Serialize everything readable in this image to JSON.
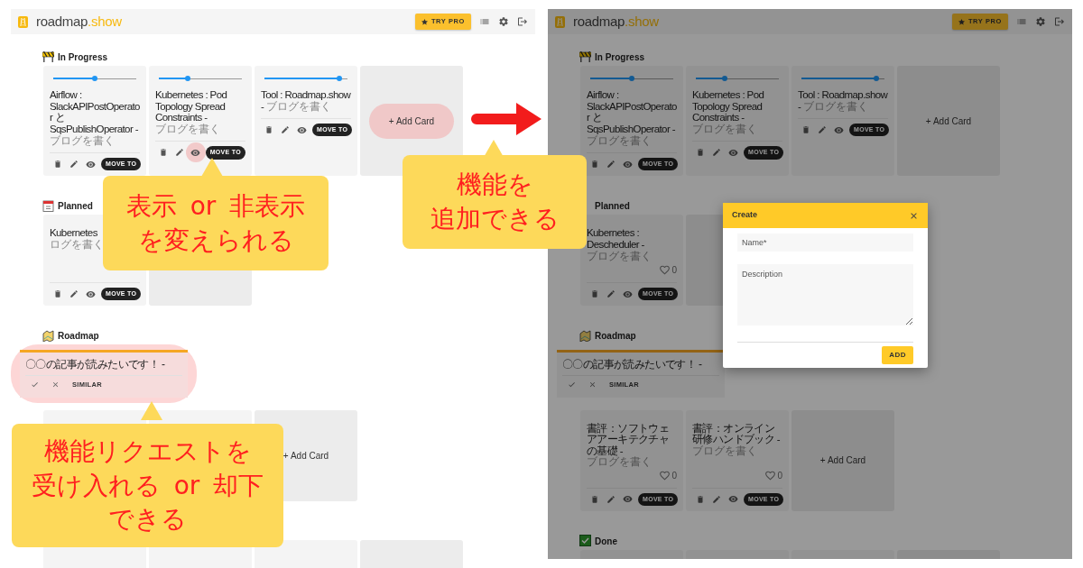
{
  "left_screen": {
    "header": {
      "logo_main": "roadmap",
      "logo_accent": ".show",
      "try_pro": "TRY PRO"
    },
    "sections": [
      {
        "kind": "in_progress",
        "title": "In Progress",
        "cards": [
          {
            "kind": "progress",
            "level": 0.5,
            "title": "Airflow : SlackAPIPostOperator と SqsPublishOperator -",
            "link": "ブログを書く",
            "view_highlighted": false,
            "move_label": "MOVE TO"
          },
          {
            "kind": "progress",
            "level": 0.35,
            "title": "Kubernetes : Pod Topology Spread Constraints -",
            "link": "ブログを書く",
            "view_highlighted": true,
            "move_label": "MOVE TO"
          },
          {
            "kind": "progress",
            "level": 0.9,
            "title": "Tool : Roadmap.show -",
            "link": "ブログを書く",
            "view_highlighted": false,
            "move_label": "MOVE TO"
          },
          {
            "kind": "add",
            "label": "+ Add Card",
            "highlighted": true
          }
        ]
      },
      {
        "kind": "planned",
        "title": "Planned",
        "cards": [
          {
            "kind": "item",
            "title": "Kubernetes",
            "link": "ログを書く",
            "line_break": true,
            "view_highlighted": false,
            "move_label": "MOVE TO"
          },
          {
            "kind": "add"
          }
        ]
      },
      {
        "kind": "roadmap",
        "title": "Roadmap",
        "requests": [
          {
            "text": "〇〇の記事が読みたいです！ -",
            "similar": "SIMILAR",
            "highlighted": true
          }
        ],
        "cards": [
          {
            "kind": "placeholder"
          },
          {
            "kind": "placeholder"
          },
          {
            "kind": "add",
            "label": "+ Add Card",
            "highlighted": false
          }
        ]
      },
      {
        "cards": [
          {
            "kind": "placeholder"
          },
          {
            "kind": "placeholder"
          },
          {
            "kind": "placeholder"
          },
          {
            "kind": "add"
          }
        ]
      }
    ]
  },
  "right_screen": {
    "header": {
      "logo_main": "roadmap",
      "logo_accent": ".show",
      "try_pro": "TRY PRO"
    },
    "sections": [
      {
        "kind": "in_progress",
        "title": "In Progress",
        "cards": [
          {
            "kind": "progress",
            "level": 0.5,
            "title": "Airflow : SlackAPIPostOperator と SqsPublishOperator -",
            "link": "ブログを書く",
            "view_highlighted": false,
            "move_label": "MOVE TO"
          },
          {
            "kind": "progress",
            "level": 0.35,
            "title": "Kubernetes : Pod Topology Spread Constraints -",
            "link": "ブログを書く",
            "view_highlighted": false,
            "move_label": "MOVE TO"
          },
          {
            "kind": "progress",
            "level": 0.9,
            "title": "Tool : Roadmap.show -",
            "link": "ブログを書く",
            "view_highlighted": false,
            "move_label": "MOVE TO"
          },
          {
            "kind": "add",
            "label": "+ Add Card",
            "highlighted": false
          }
        ]
      },
      {
        "title": "Planned",
        "cards": [
          {
            "kind": "item",
            "title": "Kubernetes : Descheduler -",
            "link": "ブログを書く",
            "likes": "0",
            "view_highlighted": false,
            "move_label": "MOVE TO"
          },
          {
            "kind": "add"
          }
        ]
      },
      {
        "kind": "roadmap",
        "title": "Roadmap",
        "requests": [
          {
            "text": "〇〇の記事が読みたいです！ -",
            "similar": "SIMILAR",
            "highlighted": false
          }
        ],
        "cards": [
          {
            "kind": "item",
            "title": "書評：ソフトウェアアーキテクチャの基礎 -",
            "link": "ブログを書く",
            "likes": "0",
            "view_highlighted": false,
            "move_label": "MOVE TO"
          },
          {
            "kind": "item",
            "title": "書評：オンライン研修ハンドブック -",
            "link": "ブログを書く",
            "likes": "0",
            "view_highlighted": false,
            "move_label": "MOVE TO"
          },
          {
            "kind": "add",
            "label": "+ Add Card",
            "highlighted": false
          }
        ]
      },
      {
        "kind": "done",
        "title": "Done",
        "cards": [
          {
            "kind": "placeholder"
          },
          {
            "kind": "placeholder"
          },
          {
            "kind": "placeholder"
          },
          {
            "kind": "add"
          }
        ]
      }
    ],
    "modal": {
      "title": "Create",
      "name_placeholder": "Name*",
      "description_placeholder": "Description",
      "add_button": "ADD"
    }
  },
  "callouts": [
    {
      "lines": [
        "表示 or 非表示",
        "を変えられる"
      ]
    },
    {
      "lines": [
        "機能を",
        "追加できる"
      ]
    },
    {
      "lines": [
        "機能リクエストを",
        "受け入れる or 却下",
        "できる"
      ]
    }
  ]
}
